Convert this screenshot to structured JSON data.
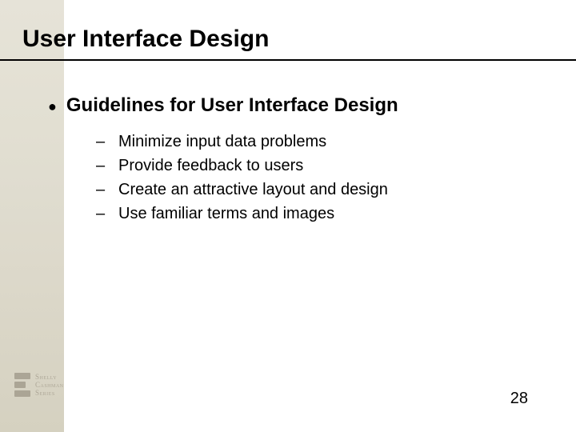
{
  "title": "User Interface Design",
  "main_bullet": "Guidelines for User Interface Design",
  "sub_items": [
    "Minimize input data problems",
    "Provide feedback to users",
    "Create an attractive layout and design",
    "Use familiar terms and images"
  ],
  "logo": {
    "line1": "Shelly",
    "line2": "Cashman",
    "line3": "Series"
  },
  "page_number": "28"
}
